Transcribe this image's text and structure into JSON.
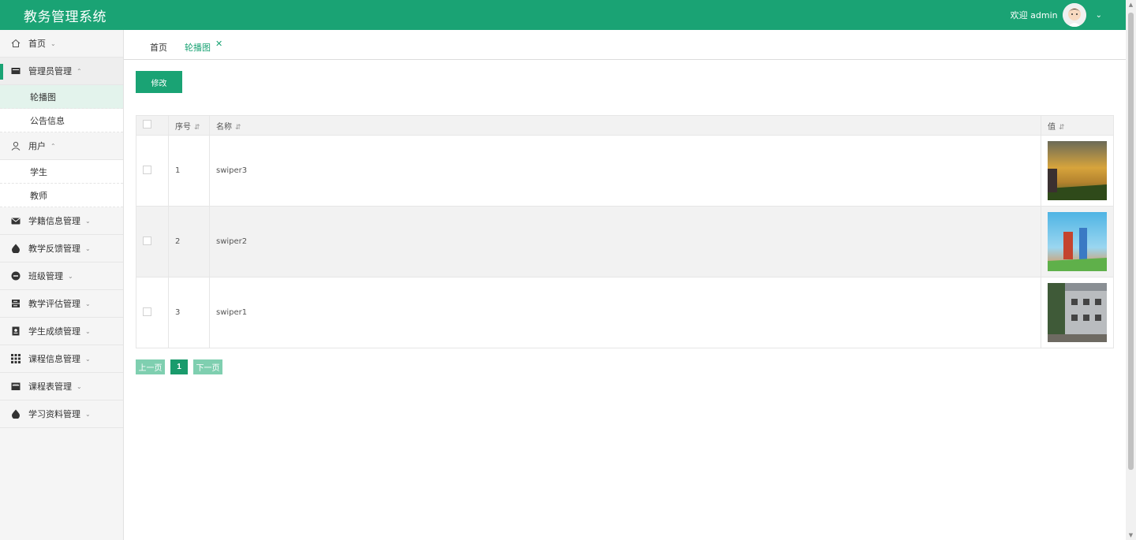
{
  "app": {
    "title": "教务管理系统"
  },
  "user": {
    "greeting": "欢迎 admin"
  },
  "sidebar": {
    "items": [
      {
        "label": "首页"
      },
      {
        "label": "管理员管理",
        "children": [
          {
            "label": "轮播图"
          },
          {
            "label": "公告信息"
          }
        ]
      },
      {
        "label": "用户",
        "children": [
          {
            "label": "学生"
          },
          {
            "label": "教师"
          }
        ]
      },
      {
        "label": "学籍信息管理"
      },
      {
        "label": "教学反馈管理"
      },
      {
        "label": "班级管理"
      },
      {
        "label": "教学评估管理"
      },
      {
        "label": "学生成绩管理"
      },
      {
        "label": "课程信息管理"
      },
      {
        "label": "课程表管理"
      },
      {
        "label": "学习资料管理"
      }
    ]
  },
  "tabs": [
    {
      "label": "首页"
    },
    {
      "label": "轮播图"
    }
  ],
  "toolbar": {
    "edit_label": "修改"
  },
  "table": {
    "headers": {
      "index": "序号",
      "name": "名称",
      "value": "值"
    },
    "rows": [
      {
        "index": "1",
        "name": "swiper3"
      },
      {
        "index": "2",
        "name": "swiper2"
      },
      {
        "index": "3",
        "name": "swiper1"
      }
    ]
  },
  "pagination": {
    "prev": "上一页",
    "current": "1",
    "next": "下一页"
  },
  "colors": {
    "brand": "#1aa374"
  }
}
